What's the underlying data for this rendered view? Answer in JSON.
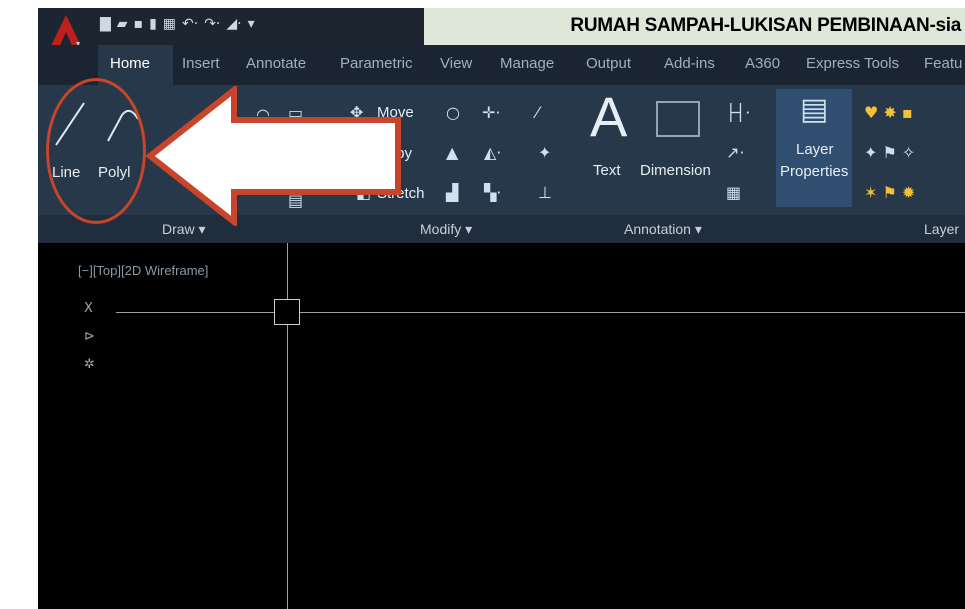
{
  "window": {
    "title": "RUMAH SAMPAH-LUKISAN PEMBINAAN-sia"
  },
  "tabs": [
    "Home",
    "Insert",
    "Annotate",
    "Parametric",
    "View",
    "Manage",
    "Output",
    "Add-ins",
    "A360",
    "Express Tools",
    "Featu"
  ],
  "ribbon": {
    "draw": {
      "line_label": "Line",
      "polyline_label": "Polyl",
      "panel_title": "Draw ▾"
    },
    "modify": {
      "move_label": "Move",
      "copy_label": "Copy",
      "stretch_label": "Stretch",
      "panel_title": "Modify ▾"
    },
    "annotation": {
      "text_label": "Text",
      "dimension_label": "Dimension",
      "panel_title": "Annotation ▾"
    },
    "layers": {
      "layer_properties_line1": "Layer",
      "layer_properties_line2": "Properties",
      "panel_title": "Layer"
    }
  },
  "viewport": {
    "label": "[−][Top][2D Wireframe]",
    "nav_x": "X"
  },
  "colors": {
    "title_bg": "#dfe8d8",
    "ribbon_bg": "#27384a",
    "tabbar_bg": "#1b2531",
    "annotation_red": "#c8442a",
    "arrow_fill": "#ffffff"
  }
}
